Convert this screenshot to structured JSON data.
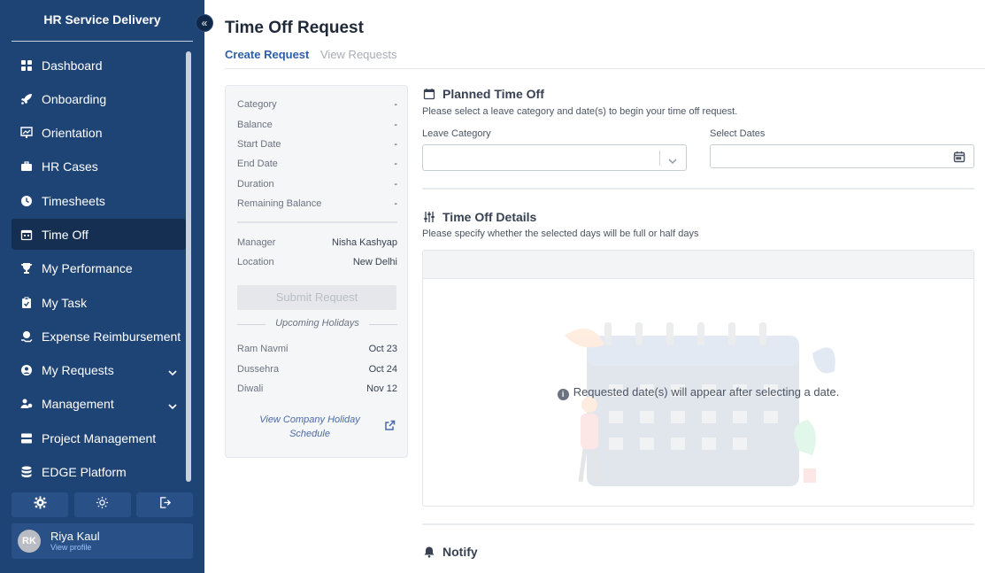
{
  "sidebar": {
    "brand": "HR Service Delivery",
    "items": [
      {
        "label": "Dashboard",
        "icon": "dashboard-icon"
      },
      {
        "label": "Onboarding",
        "icon": "rocket-icon"
      },
      {
        "label": "Orientation",
        "icon": "chart-board-icon"
      },
      {
        "label": "HR Cases",
        "icon": "briefcase-icon"
      },
      {
        "label": "Timesheets",
        "icon": "clock-icon"
      },
      {
        "label": "Time Off",
        "icon": "calendar-icon",
        "active": true
      },
      {
        "label": "My Performance",
        "icon": "trophy-icon"
      },
      {
        "label": "My Task",
        "icon": "clipboard-icon"
      },
      {
        "label": "Expense Reimbursement",
        "icon": "money-icon"
      },
      {
        "label": "My Requests",
        "icon": "user-circle-icon",
        "expandable": true
      },
      {
        "label": "Management",
        "icon": "users-cog-icon",
        "expandable": true
      },
      {
        "label": "Project Management",
        "icon": "server-icon"
      },
      {
        "label": "EDGE Platform",
        "icon": "database-icon"
      }
    ],
    "tools": [
      "gear-icon",
      "sun-icon",
      "logout-icon"
    ],
    "profile": {
      "initials": "RK",
      "name": "Riya Kaul",
      "link": "View profile"
    }
  },
  "main": {
    "title": "Time Off Request",
    "tabs": [
      {
        "label": "Create Request",
        "active": true
      },
      {
        "label": "View Requests",
        "active": false
      }
    ],
    "summary": {
      "rows": [
        {
          "label": "Category",
          "value": "-"
        },
        {
          "label": "Balance",
          "value": "-"
        },
        {
          "label": "Start Date",
          "value": "-"
        },
        {
          "label": "End Date",
          "value": "-"
        },
        {
          "label": "Duration",
          "value": "-"
        },
        {
          "label": "Remaining Balance",
          "value": "-"
        }
      ],
      "manager": {
        "label": "Manager",
        "value": "Nisha Kashyap"
      },
      "location": {
        "label": "Location",
        "value": "New Delhi"
      },
      "submit_label": "Submit Request",
      "holidays_title": "Upcoming Holidays",
      "holidays": [
        {
          "name": "Ram Navmi",
          "date": "Oct 23"
        },
        {
          "name": "Dussehra",
          "date": "Oct 24"
        },
        {
          "name": "Diwali",
          "date": "Nov 12"
        }
      ],
      "holiday_link": "View Company Holiday Schedule"
    },
    "planned": {
      "title": "Planned Time Off",
      "subtitle": "Please select a leave category and date(s) to begin your time off request.",
      "category_label": "Leave Category",
      "category_value": "",
      "dates_label": "Select Dates",
      "dates_value": ""
    },
    "details": {
      "title": "Time Off Details",
      "subtitle": "Please specify whether the selected days will be full or half days",
      "empty_message": "Requested date(s) will appear after selecting a date."
    },
    "notify": {
      "title": "Notify"
    }
  },
  "colors": {
    "sidebar": "#1e4475",
    "accent": "#2f5fa7"
  }
}
